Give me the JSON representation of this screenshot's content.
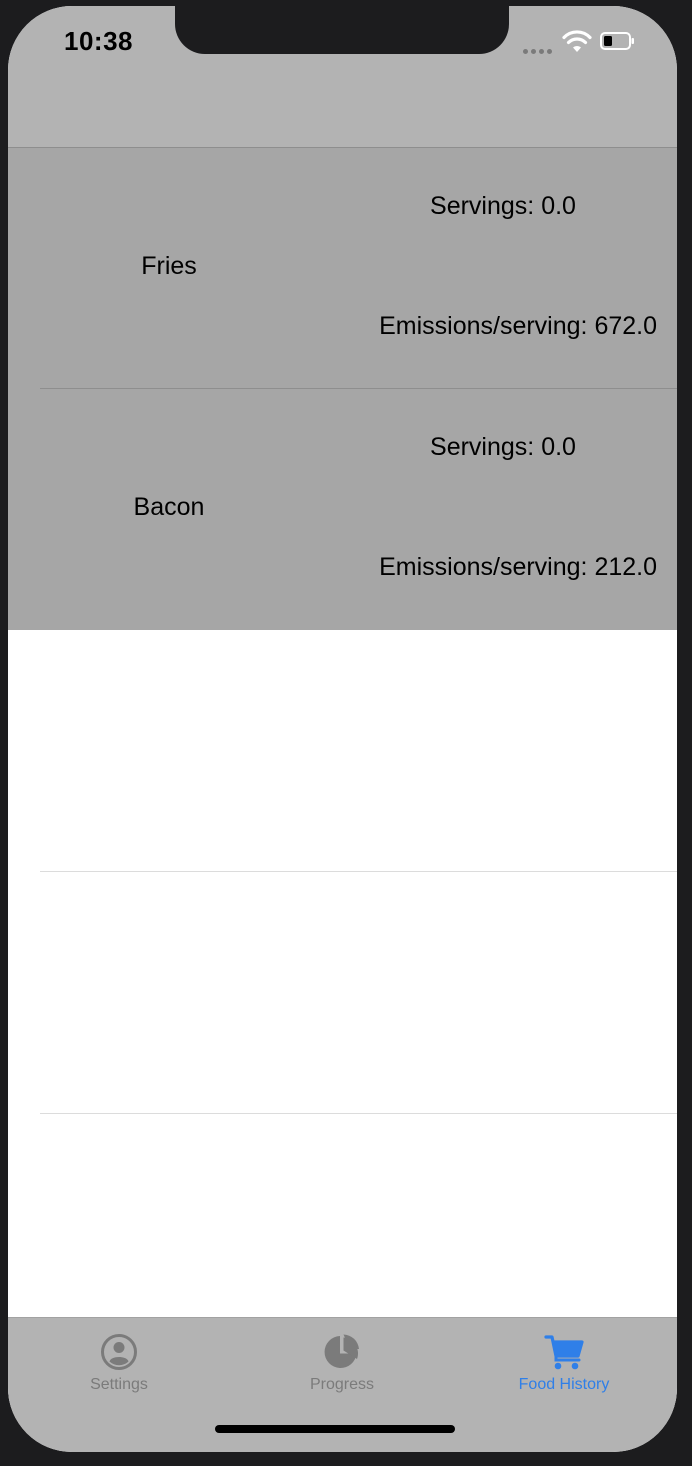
{
  "status": {
    "time": "10:38"
  },
  "food_items": [
    {
      "name": "Fries",
      "servings": "Servings: 0.0",
      "emissions": "Emissions/serving: 672.0"
    },
    {
      "name": "Bacon",
      "servings": "Servings: 0.0",
      "emissions": "Emissions/serving: 212.0"
    }
  ],
  "tabs": [
    {
      "label": "Settings",
      "icon": "person-circle-icon",
      "active": false
    },
    {
      "label": "Progress",
      "icon": "pie-chart-icon",
      "active": false
    },
    {
      "label": "Food History",
      "icon": "shopping-cart-icon",
      "active": true
    }
  ],
  "colors": {
    "accent": "#2f7fe8",
    "inactive": "#7b7b7b",
    "row_bg": "#a6a6a6"
  }
}
